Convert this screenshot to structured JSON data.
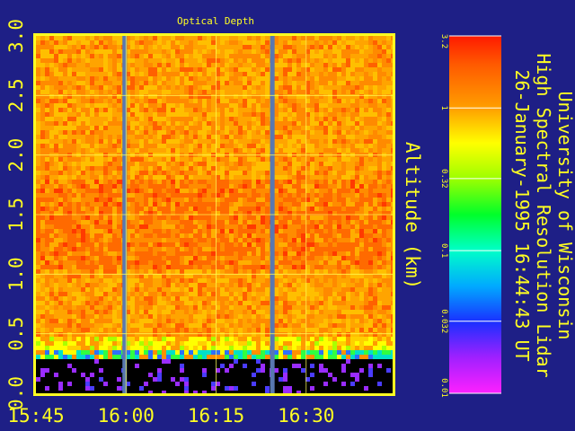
{
  "chart_data": {
    "type": "heatmap",
    "title": "Optical Depth",
    "ylabel": "Altitude (km)",
    "xlabel": "",
    "x_ticks": [
      "15:45",
      "16:00",
      "16:15",
      "16:30"
    ],
    "x_tick_values_hours": [
      15.75,
      16.0,
      16.25,
      16.5
    ],
    "xlim_hours": [
      15.75,
      16.74
    ],
    "y_ticks": [
      "0.0",
      "0.5",
      "1.0",
      "1.5",
      "2.0",
      "2.5",
      "3.0"
    ],
    "y_tick_values": [
      0.0,
      0.5,
      1.0,
      1.5,
      2.0,
      2.5,
      3.0
    ],
    "ylim": [
      0,
      3.0
    ],
    "grid": true,
    "colorbar": {
      "scale": "log",
      "range": [
        0.01,
        3.2
      ],
      "tick_labels": [
        "3.2",
        "1",
        "0.32",
        "0.1",
        "0.032",
        "0.01"
      ],
      "tick_values": [
        3.2,
        1.0,
        0.32,
        0.1,
        0.032,
        0.01
      ]
    },
    "data_gaps_hours": [
      [
        15.99,
        16.0
      ],
      [
        16.4,
        16.41
      ]
    ],
    "surface_blocked_below_km": 0.3,
    "typical_value_above_0_4km": 2.4
  },
  "header": {
    "institution": "University of Wisconsin",
    "instrument": "High Spectral Resolution Lidar",
    "timestamp": "26-January-1995 16:44:43 UT"
  },
  "colors": {
    "background": "#1e1f86",
    "axis_text": "#ffff22",
    "frame": "#ffff22",
    "gap": "#5878b0",
    "blocked": "#000000"
  }
}
